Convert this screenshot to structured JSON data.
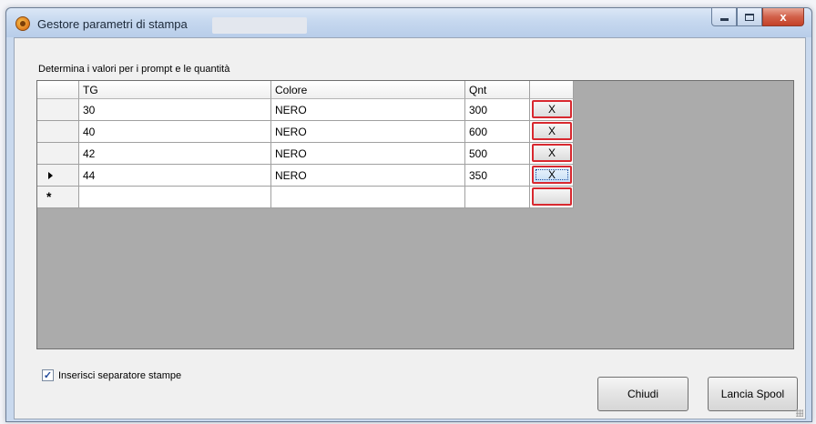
{
  "window": {
    "title": "Gestore parametri di stampa",
    "close_glyph": "x",
    "icons": [
      "app-icon",
      "minimize-icon",
      "maximize-icon",
      "close-icon"
    ]
  },
  "form": {
    "prompt_label": "Determina i valori per i prompt e le quantità",
    "separator_checkbox": {
      "label": "Inserisci separatore stampe",
      "checked": true,
      "check_glyph": "✓"
    },
    "buttons": {
      "close_label": "Chiudi",
      "spool_label": "Lancia Spool"
    }
  },
  "grid": {
    "columns": {
      "tg": "TG",
      "colore": "Colore",
      "qnt": "Qnt"
    },
    "rows": [
      {
        "tg": "30",
        "colore": "NERO",
        "qnt": "300",
        "delete_label": "X"
      },
      {
        "tg": "40",
        "colore": "NERO",
        "qnt": "600",
        "delete_label": "X"
      },
      {
        "tg": "42",
        "colore": "NERO",
        "qnt": "500",
        "delete_label": "X"
      },
      {
        "tg": "44",
        "colore": "NERO",
        "qnt": "350",
        "delete_label": "X",
        "current": true
      }
    ],
    "new_row_glyph": "*",
    "colors": {
      "delete_border": "#d8282f",
      "empty_area": "#ababab"
    }
  }
}
